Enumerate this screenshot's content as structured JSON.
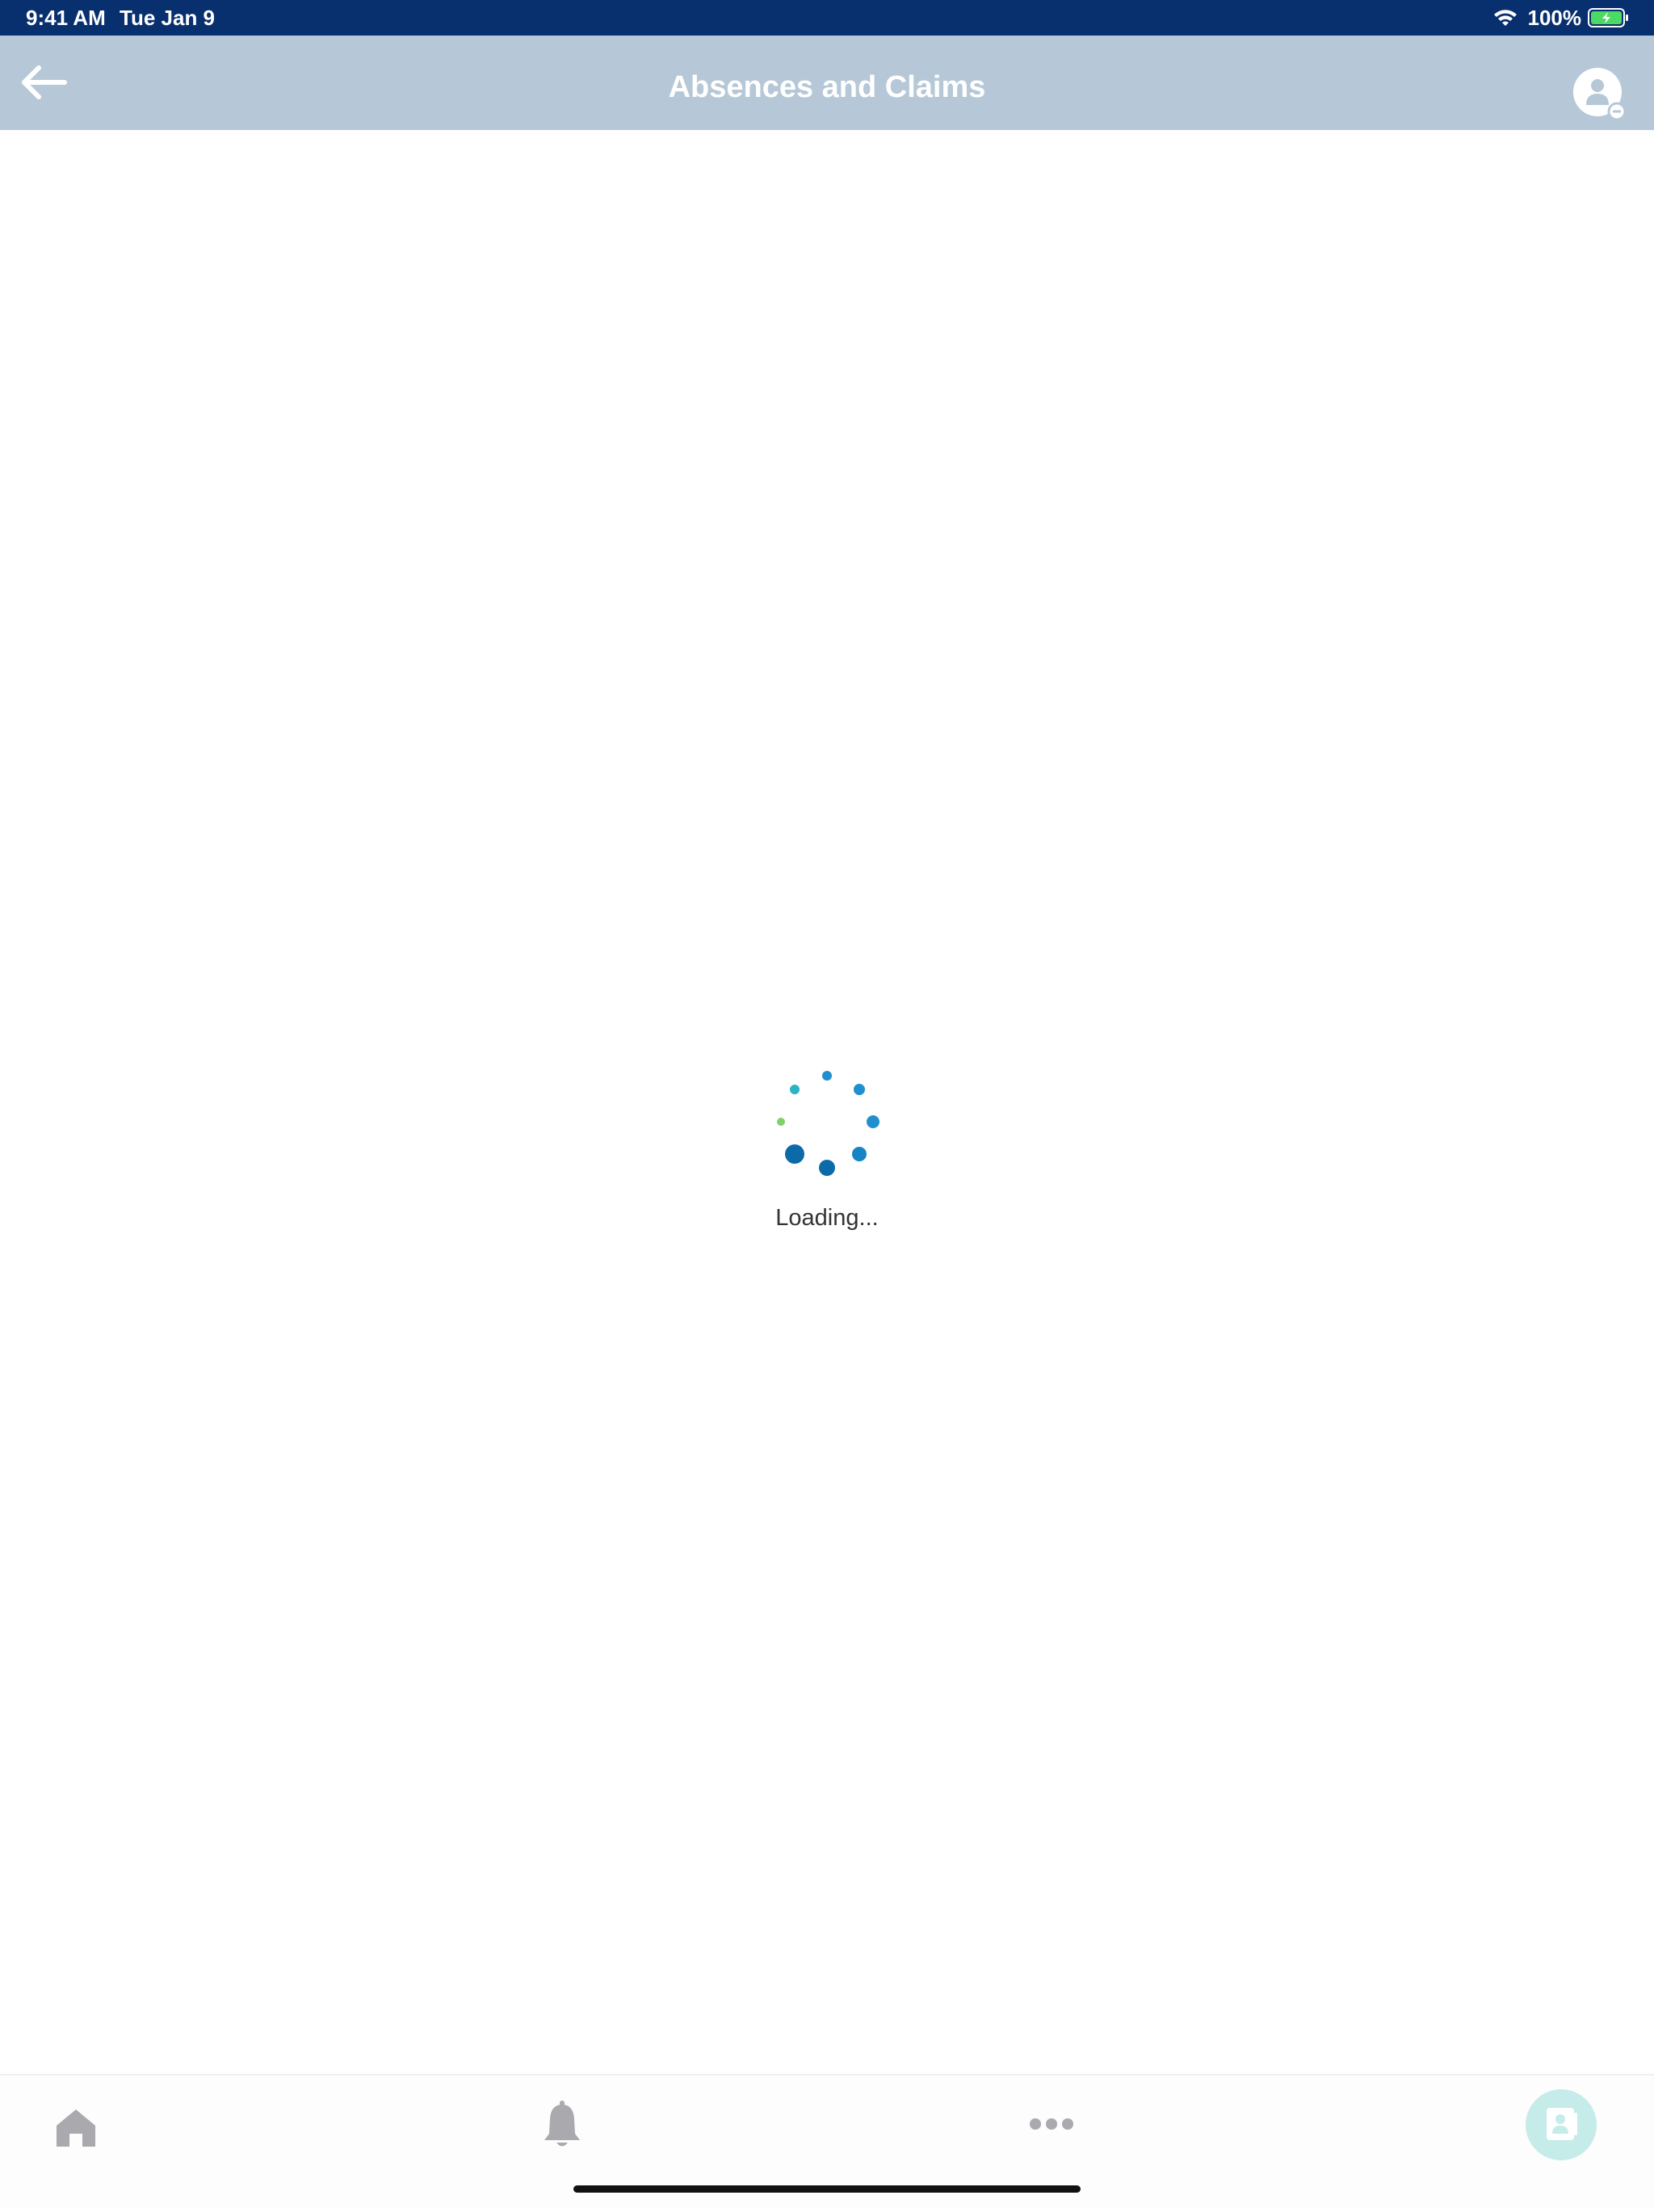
{
  "status_bar": {
    "time": "9:41 AM",
    "date": "Tue Jan 9",
    "battery": "100%",
    "icons": [
      "wifi-icon",
      "battery-charging-icon"
    ]
  },
  "nav_bar": {
    "title": "Absences and Claims",
    "back_icon": "arrow-left-icon",
    "profile_icon": "user-profile-icon"
  },
  "main": {
    "loading_text": "Loading...",
    "spinner_icon": "loading-spinner-icon"
  },
  "tab_bar": {
    "tabs": [
      {
        "icon": "home-icon"
      },
      {
        "icon": "bell-icon"
      },
      {
        "icon": "more-dots-icon"
      },
      {
        "icon": "contact-card-icon"
      }
    ]
  },
  "colors": {
    "status_bar_bg": "#082f6e",
    "nav_bar_bg": "#b6c8d7",
    "spinner_dark": "#0d6aa8",
    "spinner_mid": "#1f8fd0",
    "spinner_teal": "#2ab3c4",
    "spinner_green": "#7ed06a",
    "tab_icon_gray": "#a9a9ae",
    "contact_button_bg": "#c6ece9"
  }
}
